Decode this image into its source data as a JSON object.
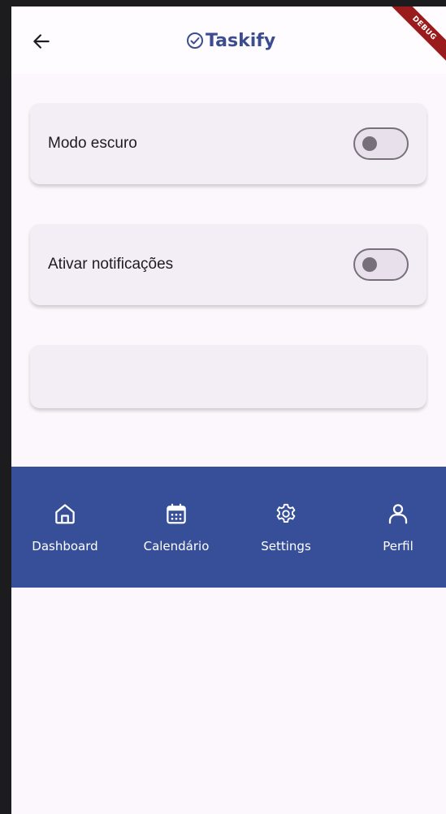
{
  "appbar": {
    "title": "Taskify",
    "debug_banner": "DEBUG"
  },
  "settings": [
    {
      "label": "Modo escuro",
      "enabled": false
    },
    {
      "label": "Ativar notificações",
      "enabled": false
    },
    {
      "label": ""
    }
  ],
  "nav": {
    "items": [
      {
        "label": "Dashboard",
        "icon": "home-icon"
      },
      {
        "label": "Calendário",
        "icon": "calendar-icon"
      },
      {
        "label": "Settings",
        "icon": "gear-icon"
      },
      {
        "label": "Perfil",
        "icon": "person-icon"
      }
    ]
  },
  "colors": {
    "primary": "#364f98",
    "title": "#3b4d8f",
    "background": "#fbf7fc",
    "card": "#f3edf5"
  }
}
